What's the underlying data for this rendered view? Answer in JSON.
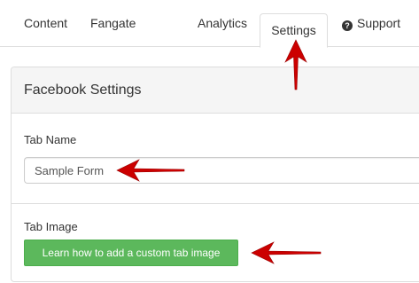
{
  "tabs": {
    "content": "Content",
    "fangate": "Fangate",
    "analytics": "Analytics",
    "settings": "Settings",
    "support": "Support"
  },
  "active_tab": "Settings",
  "panel": {
    "title": "Facebook Settings",
    "tab_name_label": "Tab Name",
    "tab_name_value": "Sample Form",
    "tab_image_label": "Tab Image",
    "tab_image_button": "Learn how to add a custom tab image"
  },
  "colors": {
    "button_green": "#5cb85c",
    "annotation_red": "#cc0000",
    "heading_bg": "#f5f5f5"
  },
  "icons": {
    "support": "question-circle-icon",
    "annotations": "red-arrow-icon"
  }
}
